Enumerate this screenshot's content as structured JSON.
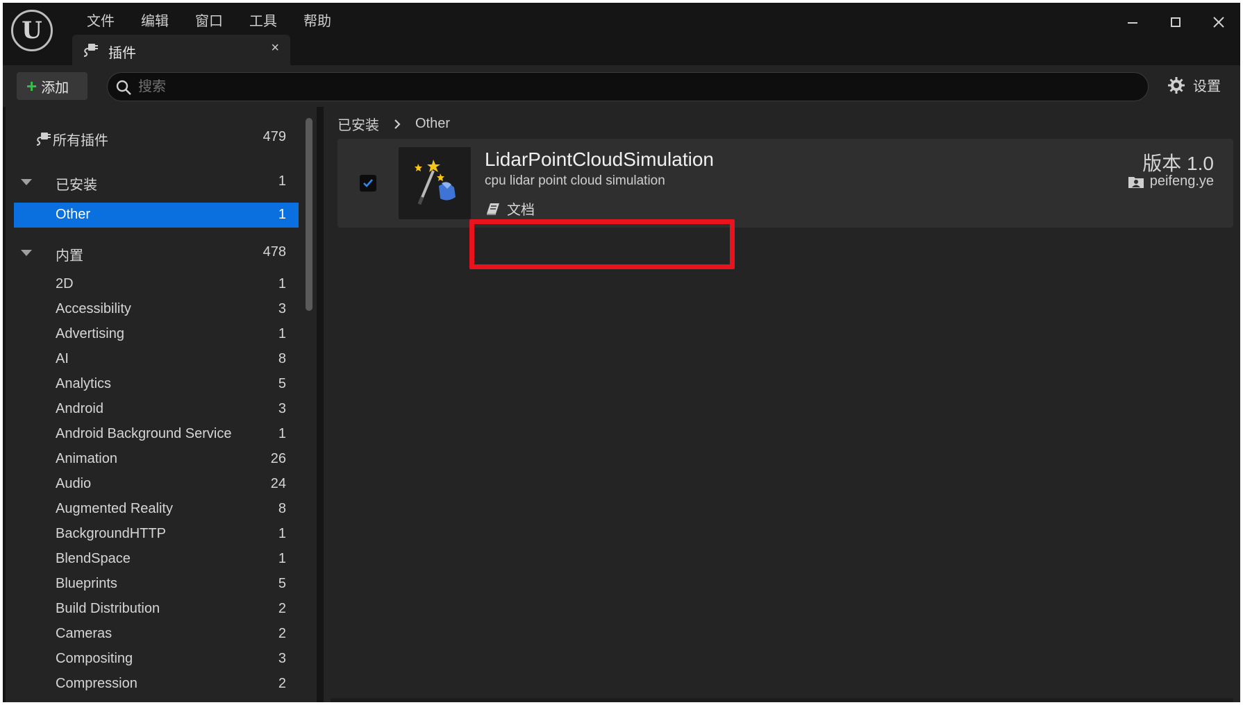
{
  "menu": [
    "文件",
    "编辑",
    "窗口",
    "工具",
    "帮助"
  ],
  "tab": {
    "title": "插件",
    "close": "×"
  },
  "window_controls": {
    "minimize": "—",
    "maximize": "☐",
    "close": "✕"
  },
  "toolbar": {
    "add_label": "添加",
    "search_placeholder": "搜索",
    "settings_label": "设置"
  },
  "sidebar": {
    "all": {
      "label": "所有插件",
      "count": "479"
    },
    "installed": {
      "label": "已安装",
      "count": "1"
    },
    "installed_children": [
      {
        "label": "Other",
        "count": "1",
        "selected": true
      }
    ],
    "builtin": {
      "label": "内置",
      "count": "478"
    },
    "builtin_children": [
      {
        "label": "2D",
        "count": "1"
      },
      {
        "label": "Accessibility",
        "count": "3"
      },
      {
        "label": "Advertising",
        "count": "1"
      },
      {
        "label": "AI",
        "count": "8"
      },
      {
        "label": "Analytics",
        "count": "5"
      },
      {
        "label": "Android",
        "count": "3"
      },
      {
        "label": "Android Background Service",
        "count": "1"
      },
      {
        "label": "Animation",
        "count": "26"
      },
      {
        "label": "Audio",
        "count": "24"
      },
      {
        "label": "Augmented Reality",
        "count": "8"
      },
      {
        "label": "BackgroundHTTP",
        "count": "1"
      },
      {
        "label": "BlendSpace",
        "count": "1"
      },
      {
        "label": "Blueprints",
        "count": "5"
      },
      {
        "label": "Build Distribution",
        "count": "2"
      },
      {
        "label": "Cameras",
        "count": "2"
      },
      {
        "label": "Compositing",
        "count": "3"
      },
      {
        "label": "Compression",
        "count": "2"
      }
    ]
  },
  "breadcrumb": {
    "root": "已安装",
    "current": "Other"
  },
  "plugin": {
    "name": "LidarPointCloudSimulation",
    "description": "cpu lidar point cloud simulation",
    "docs_label": "文档",
    "version": "版本 1.0",
    "author": "peifeng.ye",
    "enabled": true
  },
  "colors": {
    "accent": "#0a70e0",
    "highlight": "#e8131c",
    "add": "#36c24a"
  }
}
